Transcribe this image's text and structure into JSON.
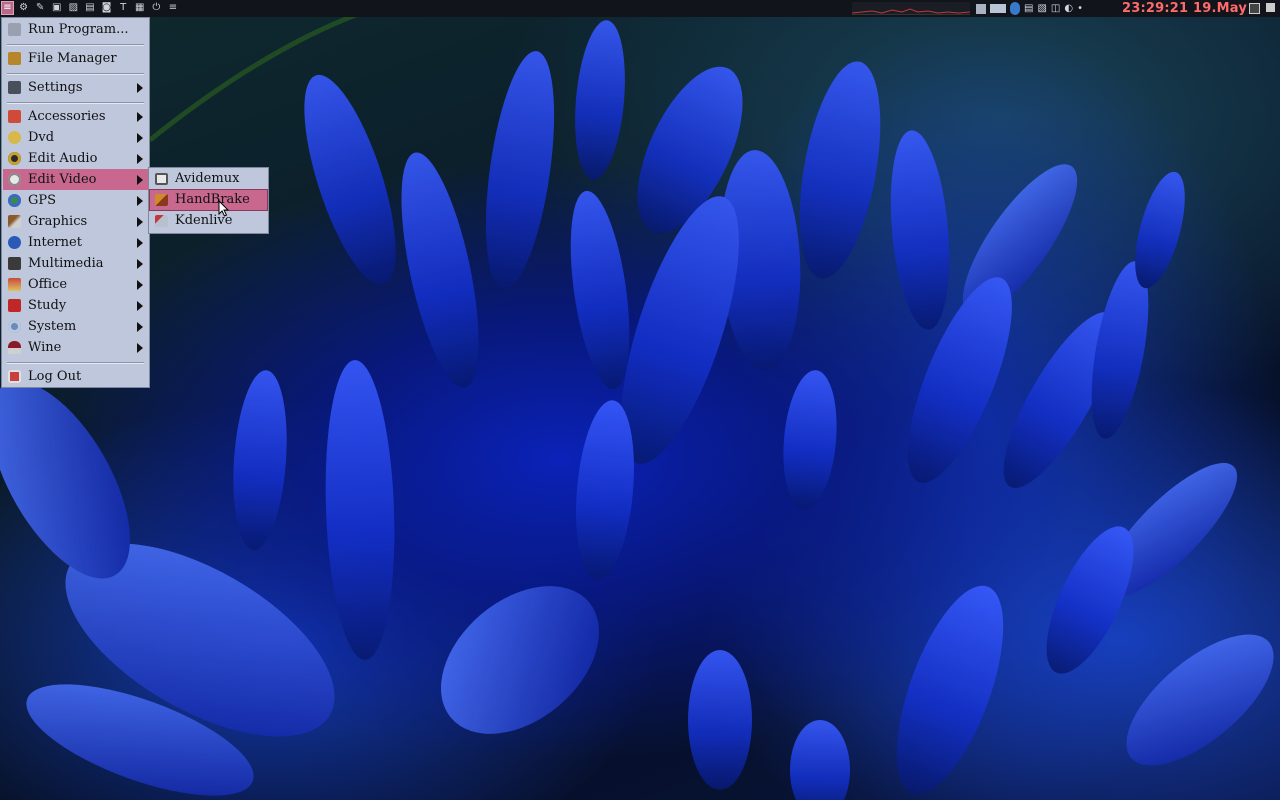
{
  "panel": {
    "clock": "23:29:21 19.May",
    "launcher_icons": [
      "menu-icon",
      "gear-icon",
      "wrench-icon",
      "terminal-icon",
      "image-icon",
      "console-icon",
      "screenshot-icon",
      "text-icon",
      "calendar-icon",
      "power-icon",
      "notes-icon"
    ]
  },
  "main_menu": {
    "items": [
      {
        "label": "Run Program...",
        "icon": "run-icon",
        "submenu": false
      },
      {
        "label": "File Manager",
        "icon": "folder-icon",
        "submenu": false
      },
      {
        "label": "Settings",
        "icon": "settings-icon",
        "submenu": true
      },
      {
        "label": "Accessories",
        "icon": "accessories-icon",
        "submenu": true
      },
      {
        "label": "Dvd",
        "icon": "dvd-icon",
        "submenu": true
      },
      {
        "label": "Edit Audio",
        "icon": "audio-icon",
        "submenu": true
      },
      {
        "label": "Edit Video",
        "icon": "video-icon",
        "submenu": true
      },
      {
        "label": "GPS",
        "icon": "globe-icon",
        "submenu": true
      },
      {
        "label": "Graphics",
        "icon": "brush-icon",
        "submenu": true
      },
      {
        "label": "Internet",
        "icon": "internet-icon",
        "submenu": true
      },
      {
        "label": "Multimedia",
        "icon": "multimedia-icon",
        "submenu": true
      },
      {
        "label": "Office",
        "icon": "office-icon",
        "submenu": true
      },
      {
        "label": "Study",
        "icon": "study-icon",
        "submenu": true
      },
      {
        "label": "System",
        "icon": "system-icon",
        "submenu": true
      },
      {
        "label": "Wine",
        "icon": "wine-icon",
        "submenu": true
      },
      {
        "label": "Log Out",
        "icon": "logout-icon",
        "submenu": false
      }
    ],
    "active_item": "Edit Video"
  },
  "edit_video_submenu": {
    "items": [
      {
        "label": "Avidemux",
        "icon": "avidemux-icon"
      },
      {
        "label": "HandBrake",
        "icon": "handbrake-icon"
      },
      {
        "label": "Kdenlive",
        "icon": "kdenlive-icon"
      }
    ],
    "active_item": "HandBrake"
  },
  "colors": {
    "menu_bg": "#bfc7dc",
    "highlight": "#c8688e",
    "clock": "#ff6a6a",
    "panel_bg": "#12141b"
  }
}
